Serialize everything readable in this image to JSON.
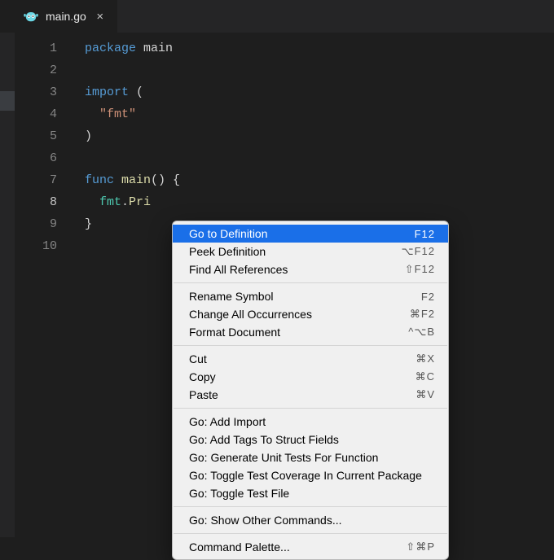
{
  "tab": {
    "filename": "main.go",
    "icon_name": "go-gopher-icon"
  },
  "gutter": {
    "line_count": 10,
    "current_line": 8
  },
  "code": {
    "lines": [
      [
        {
          "cls": "tok-kw",
          "t": "package"
        },
        {
          "cls": "tok-plain",
          "t": " "
        },
        {
          "cls": "tok-ident",
          "t": "main"
        }
      ],
      [],
      [
        {
          "cls": "tok-kw",
          "t": "import"
        },
        {
          "cls": "tok-plain",
          "t": " ("
        }
      ],
      [
        {
          "cls": "tok-plain",
          "t": "  "
        },
        {
          "cls": "tok-str",
          "t": "\"fmt\""
        }
      ],
      [
        {
          "cls": "tok-plain",
          "t": ")"
        }
      ],
      [],
      [
        {
          "cls": "tok-kw",
          "t": "func"
        },
        {
          "cls": "tok-plain",
          "t": " "
        },
        {
          "cls": "tok-func",
          "t": "main"
        },
        {
          "cls": "tok-plain",
          "t": "() {"
        }
      ],
      [
        {
          "cls": "tok-plain",
          "t": "  "
        },
        {
          "cls": "tok-pkg",
          "t": "fmt"
        },
        {
          "cls": "tok-plain",
          "t": "."
        },
        {
          "cls": "tok-func",
          "t": "Pri"
        }
      ],
      [
        {
          "cls": "tok-plain",
          "t": "}"
        }
      ],
      []
    ]
  },
  "context_menu": {
    "groups": [
      [
        {
          "label": "Go to Definition",
          "shortcut": "F12",
          "selected": true
        },
        {
          "label": "Peek Definition",
          "shortcut": "⌥F12"
        },
        {
          "label": "Find All References",
          "shortcut": "⇧F12"
        }
      ],
      [
        {
          "label": "Rename Symbol",
          "shortcut": "F2"
        },
        {
          "label": "Change All Occurrences",
          "shortcut": "⌘F2"
        },
        {
          "label": "Format Document",
          "shortcut": "^⌥B"
        }
      ],
      [
        {
          "label": "Cut",
          "shortcut": "⌘X"
        },
        {
          "label": "Copy",
          "shortcut": "⌘C"
        },
        {
          "label": "Paste",
          "shortcut": "⌘V"
        }
      ],
      [
        {
          "label": "Go: Add Import"
        },
        {
          "label": "Go: Add Tags To Struct Fields"
        },
        {
          "label": "Go: Generate Unit Tests For Function"
        },
        {
          "label": "Go: Toggle Test Coverage In Current Package"
        },
        {
          "label": "Go: Toggle Test File"
        }
      ],
      [
        {
          "label": "Go: Show Other Commands..."
        }
      ],
      [
        {
          "label": "Command Palette...",
          "shortcut": "⇧⌘P"
        }
      ]
    ]
  }
}
